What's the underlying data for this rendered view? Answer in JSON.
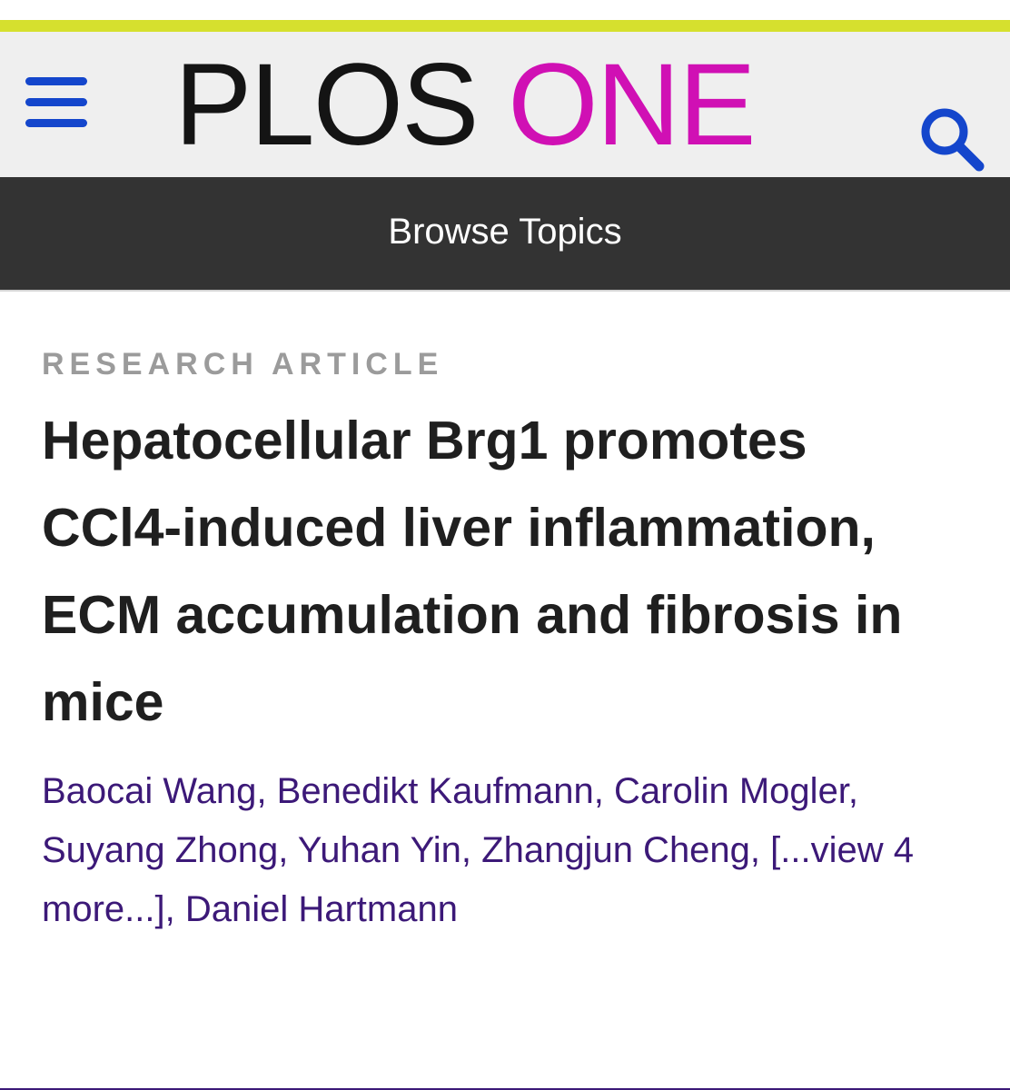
{
  "header": {
    "logo_part1": "PLOS",
    "logo_part2": "ONE",
    "colors": {
      "accent_bar": "#d6e02e",
      "logo_primary": "#141414",
      "logo_accent": "#d010b4",
      "icon_blue": "#1446cc",
      "nav_bar": "#333333"
    }
  },
  "nav": {
    "browse_label": "Browse Topics"
  },
  "article": {
    "type": "RESEARCH ARTICLE",
    "title": "Hepatocellular Brg1 promotes CCl4-induced liver inflammation, ECM accumulation and fibrosis in mice",
    "authors": {
      "a1": "Baocai Wang",
      "a2": "Benedikt Kaufmann",
      "a3": "Carolin Mogler",
      "a4": "Suyang Zhong",
      "a5": "Yuhan Yin",
      "a6": "Zhangjun Cheng",
      "more": "[...view 4 more...]",
      "last": "Daniel Hartmann"
    },
    "author_color": "#3c1978"
  },
  "icons": {
    "menu": "hamburger-menu-icon",
    "search": "search-icon"
  }
}
